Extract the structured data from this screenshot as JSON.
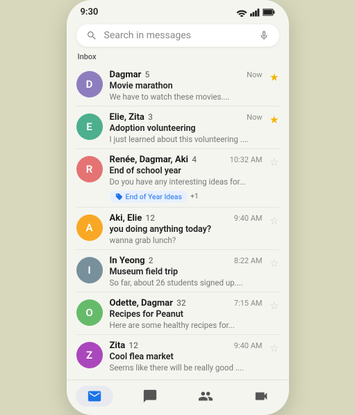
{
  "statusBar": {
    "time": "9:30"
  },
  "search": {
    "placeholder": "Search in messages"
  },
  "inboxLabel": "Inbox",
  "messages": [
    {
      "id": "dagmar",
      "sender": "Dagmar",
      "count": "5",
      "subject": "Movie marathon",
      "preview": "We have to watch these movies....",
      "time": "Now",
      "starred": true,
      "avatarColor": "#8e7dbe",
      "avatarText": "D",
      "hasChip": false
    },
    {
      "id": "elie-zita",
      "sender": "Elie, Zita",
      "count": "3",
      "subject": "Adoption volunteering",
      "preview": "I just learned about this volunteering ....",
      "time": "Now",
      "starred": true,
      "avatarColor": "#4caf8e",
      "avatarText": "E",
      "hasChip": false
    },
    {
      "id": "renee-dagmar-aki",
      "sender": "Renée, Dagmar, Aki",
      "count": "4",
      "subject": "End of school year",
      "preview": "Do you have any interesting ideas for...",
      "time": "10:32 AM",
      "starred": false,
      "avatarColor": "#e57373",
      "avatarText": "R",
      "hasChip": true,
      "chipLabel": "End of Year Ideas",
      "chipExtra": "+1"
    },
    {
      "id": "aki-elie",
      "sender": "Aki, Elie",
      "count": "12",
      "subject": "you doing anything today?",
      "preview": "wanna grab lunch?",
      "time": "9:40 AM",
      "starred": false,
      "avatarColor": "#f9a825",
      "avatarText": "A",
      "hasChip": false
    },
    {
      "id": "in-yeong",
      "sender": "In Yeong",
      "count": "2",
      "subject": "Museum field trip",
      "preview": "So far, about 26 students signed up....",
      "time": "8:22 AM",
      "starred": false,
      "avatarColor": "#78909c",
      "avatarText": "I",
      "hasChip": false
    },
    {
      "id": "odette-dagmar",
      "sender": "Odette, Dagmar",
      "count": "32",
      "subject": "Recipes for Peanut",
      "preview": "Here are some healthy recipes for...",
      "time": "7:15 AM",
      "starred": false,
      "avatarColor": "#66bb6a",
      "avatarText": "O",
      "hasChip": false
    },
    {
      "id": "zita",
      "sender": "Zita",
      "count": "12",
      "subject": "Cool flea market",
      "preview": "Seems like there will be really good ....",
      "time": "9:40 AM",
      "starred": false,
      "avatarColor": "#ab47bc",
      "avatarText": "Z",
      "hasChip": false
    }
  ],
  "bottomNav": [
    {
      "id": "mail",
      "label": "Mail",
      "active": true
    },
    {
      "id": "chat",
      "label": "Chat",
      "active": false
    },
    {
      "id": "spaces",
      "label": "Spaces",
      "active": false
    },
    {
      "id": "meet",
      "label": "Meet",
      "active": false
    }
  ]
}
